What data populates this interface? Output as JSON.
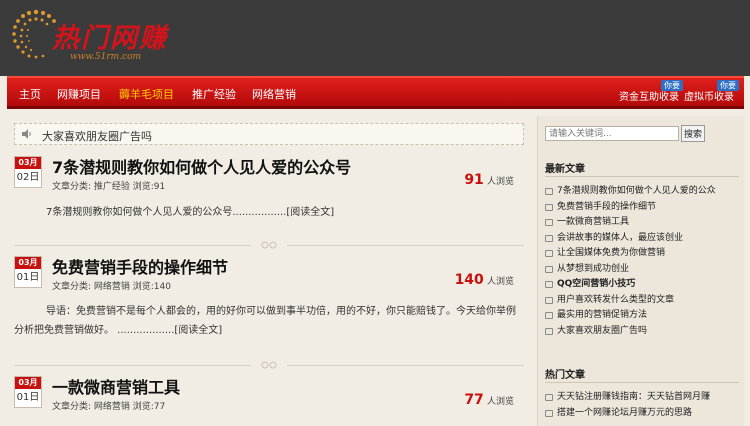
{
  "logo": {
    "text": "热门网赚",
    "url": "www.51rm.com"
  },
  "colors": {
    "accent": "#c8100e",
    "header": "#3b3b3b",
    "nav_active": "#ffd200",
    "tag": "#2d6fc4"
  },
  "nav": {
    "items": [
      {
        "label": "主页",
        "active": false
      },
      {
        "label": "网赚项目",
        "active": false
      },
      {
        "label": "薅羊毛项目",
        "active": true
      },
      {
        "label": "推广经验",
        "active": false
      },
      {
        "label": "网络营销",
        "active": false
      }
    ],
    "right": [
      {
        "label": "资金互助收录",
        "tag": "你要"
      },
      {
        "label": "虚拟币收录",
        "tag": "你要"
      }
    ]
  },
  "notice": {
    "icon": "speaker-icon",
    "text": "大家喜欢朋友圈广告吗"
  },
  "posts": [
    {
      "month": "03月",
      "day": "02日",
      "title": "7条潜规则教你如何做个人见人爱的公众号",
      "meta": "文章分类: 推广经验  浏览:91",
      "views": "91",
      "views_unit": "人浏览",
      "excerpt": "7条潜规则教你如何做个人见人爱的公众号.................[阅读全文]"
    },
    {
      "month": "03月",
      "day": "01日",
      "title": "免费营销手段的操作细节",
      "meta": "文章分类: 网络营销  浏览:140",
      "views": "140",
      "views_unit": "人浏览",
      "excerpt": "导语：免费营销不是每个人都会的，用的好你可以做到事半功倍，用的不好，你只能赔钱了。今天给你举例分析把免费营销做好。 ..................[阅读全文]"
    },
    {
      "month": "03月",
      "day": "01日",
      "title": "一款微商营销工具",
      "meta": "文章分类: 网络营销  浏览:77",
      "views": "77",
      "views_unit": "人浏览",
      "excerpt": ""
    }
  ],
  "sidebar": {
    "search_placeholder": "请输入关键词...",
    "search_button": "搜索",
    "latest_title": "最新文章",
    "latest": [
      {
        "text": "7条潜规则教你如何做个人见人爱的公众",
        "bold": false
      },
      {
        "text": "免费营销手段的操作细节",
        "bold": false
      },
      {
        "text": "一款微商营销工具",
        "bold": false
      },
      {
        "text": "会讲故事的媒体人，最应该创业",
        "bold": false
      },
      {
        "text": "让全国媒体免费为你做营销",
        "bold": false
      },
      {
        "text": "从梦想到成功创业",
        "bold": false
      },
      {
        "text": "QQ空间营销小技巧",
        "bold": true
      },
      {
        "text": "用户喜欢转发什么类型的文章",
        "bold": false
      },
      {
        "text": "最实用的营销促销方法",
        "bold": false
      },
      {
        "text": "大家喜欢朋友圈广告吗",
        "bold": false
      }
    ],
    "hot_title": "热门文章",
    "hot": [
      {
        "text": "天天钻注册赚钱指南：天天钻首网月赚",
        "bold": false
      },
      {
        "text": "搭建一个网赚论坛月赚万元的思路",
        "bold": false
      }
    ]
  }
}
